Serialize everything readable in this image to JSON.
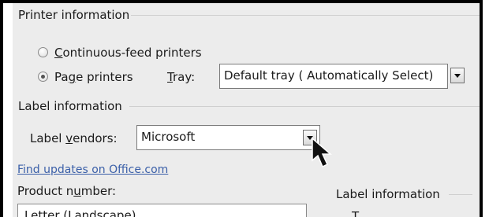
{
  "printer_info": {
    "heading": "Printer information",
    "continuous_feed": {
      "prefix": "",
      "key": "C",
      "rest": "ontinuous-feed printers",
      "selected": false
    },
    "page_printers": {
      "prefix": "Pa",
      "key": "g",
      "rest": "e printers",
      "selected": true
    },
    "tray": {
      "key": "T",
      "rest": "ray:",
      "value": "Default tray ( Automatically Select)"
    }
  },
  "label_info": {
    "heading": "Label information",
    "vendors": {
      "prefix": "Label ",
      "key": "v",
      "rest": "endors:",
      "value": "Microsoft"
    },
    "find_updates_link": "Find updates on Office.com",
    "product_number": {
      "prefix": "Product n",
      "key": "u",
      "rest": "mber:"
    },
    "product_list": [
      "Letter (Landscape)"
    ],
    "side_panel_heading": "Label information",
    "side_panel_partial": "T"
  }
}
